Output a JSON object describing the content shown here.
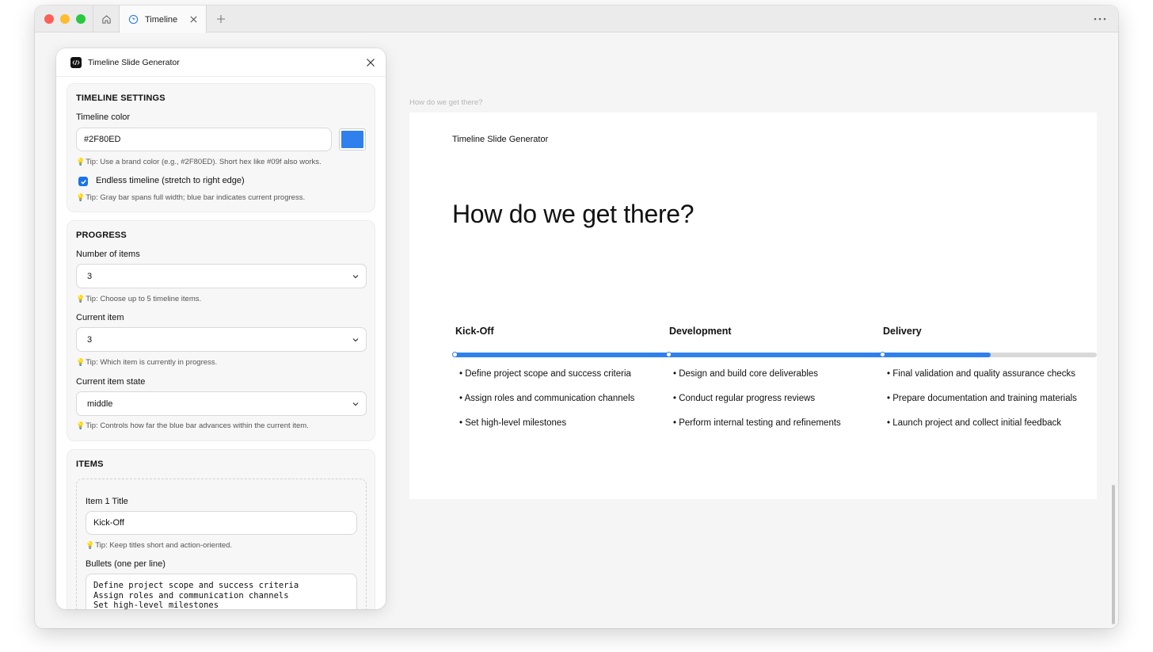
{
  "window": {
    "tab_title": "Timeline",
    "colors": {
      "accent": "#2F80ED",
      "track": "#d9d9d9"
    }
  },
  "panel": {
    "title": "Timeline Slide Generator",
    "settings": {
      "section_title": "TIMELINE SETTINGS",
      "color_label": "Timeline color",
      "color_value": "#2F80ED",
      "color_tip": "Tip: Use a brand color (e.g., #2F80ED). Short hex like #09f also works.",
      "endless_label": "Endless timeline (stretch to right edge)",
      "endless_checked": true,
      "endless_tip": "Tip: Gray bar spans full width; blue bar indicates current progress."
    },
    "progress": {
      "section_title": "PROGRESS",
      "count_label": "Number of items",
      "count_value": "3",
      "count_tip": "Tip: Choose up to 5 timeline items.",
      "current_label": "Current item",
      "current_value": "3",
      "current_tip": "Tip: Which item is currently in progress.",
      "state_label": "Current item state",
      "state_value": "middle",
      "state_tip": "Tip: Controls how far the blue bar advances within the current item."
    },
    "items": {
      "section_title": "ITEMS",
      "item1_title_label": "Item 1 Title",
      "item1_title_value": "Kick-Off",
      "item1_title_tip": "Tip: Keep titles short and action-oriented.",
      "bullets_label": "Bullets (one per line)",
      "bullets_value": "Define project scope and success criteria\nAssign roles and communication channels\nSet high-level milestones"
    }
  },
  "slide": {
    "caption": "How do we get there?",
    "brand": "Timeline Slide Generator",
    "heading": "How do we get there?",
    "progress_fraction": 0.835,
    "milestones": [
      {
        "title": "Kick-Off",
        "bullets": [
          "Define project scope and success criteria",
          "Assign roles and communication channels",
          "Set high-level milestones"
        ]
      },
      {
        "title": "Development",
        "bullets": [
          "Design and build core deliverables",
          "Conduct regular progress reviews",
          "Perform internal testing and refinements"
        ]
      },
      {
        "title": "Delivery",
        "bullets": [
          "Final validation and quality assurance checks",
          "Prepare documentation and training materials",
          "Launch project and collect initial feedback"
        ]
      }
    ]
  }
}
